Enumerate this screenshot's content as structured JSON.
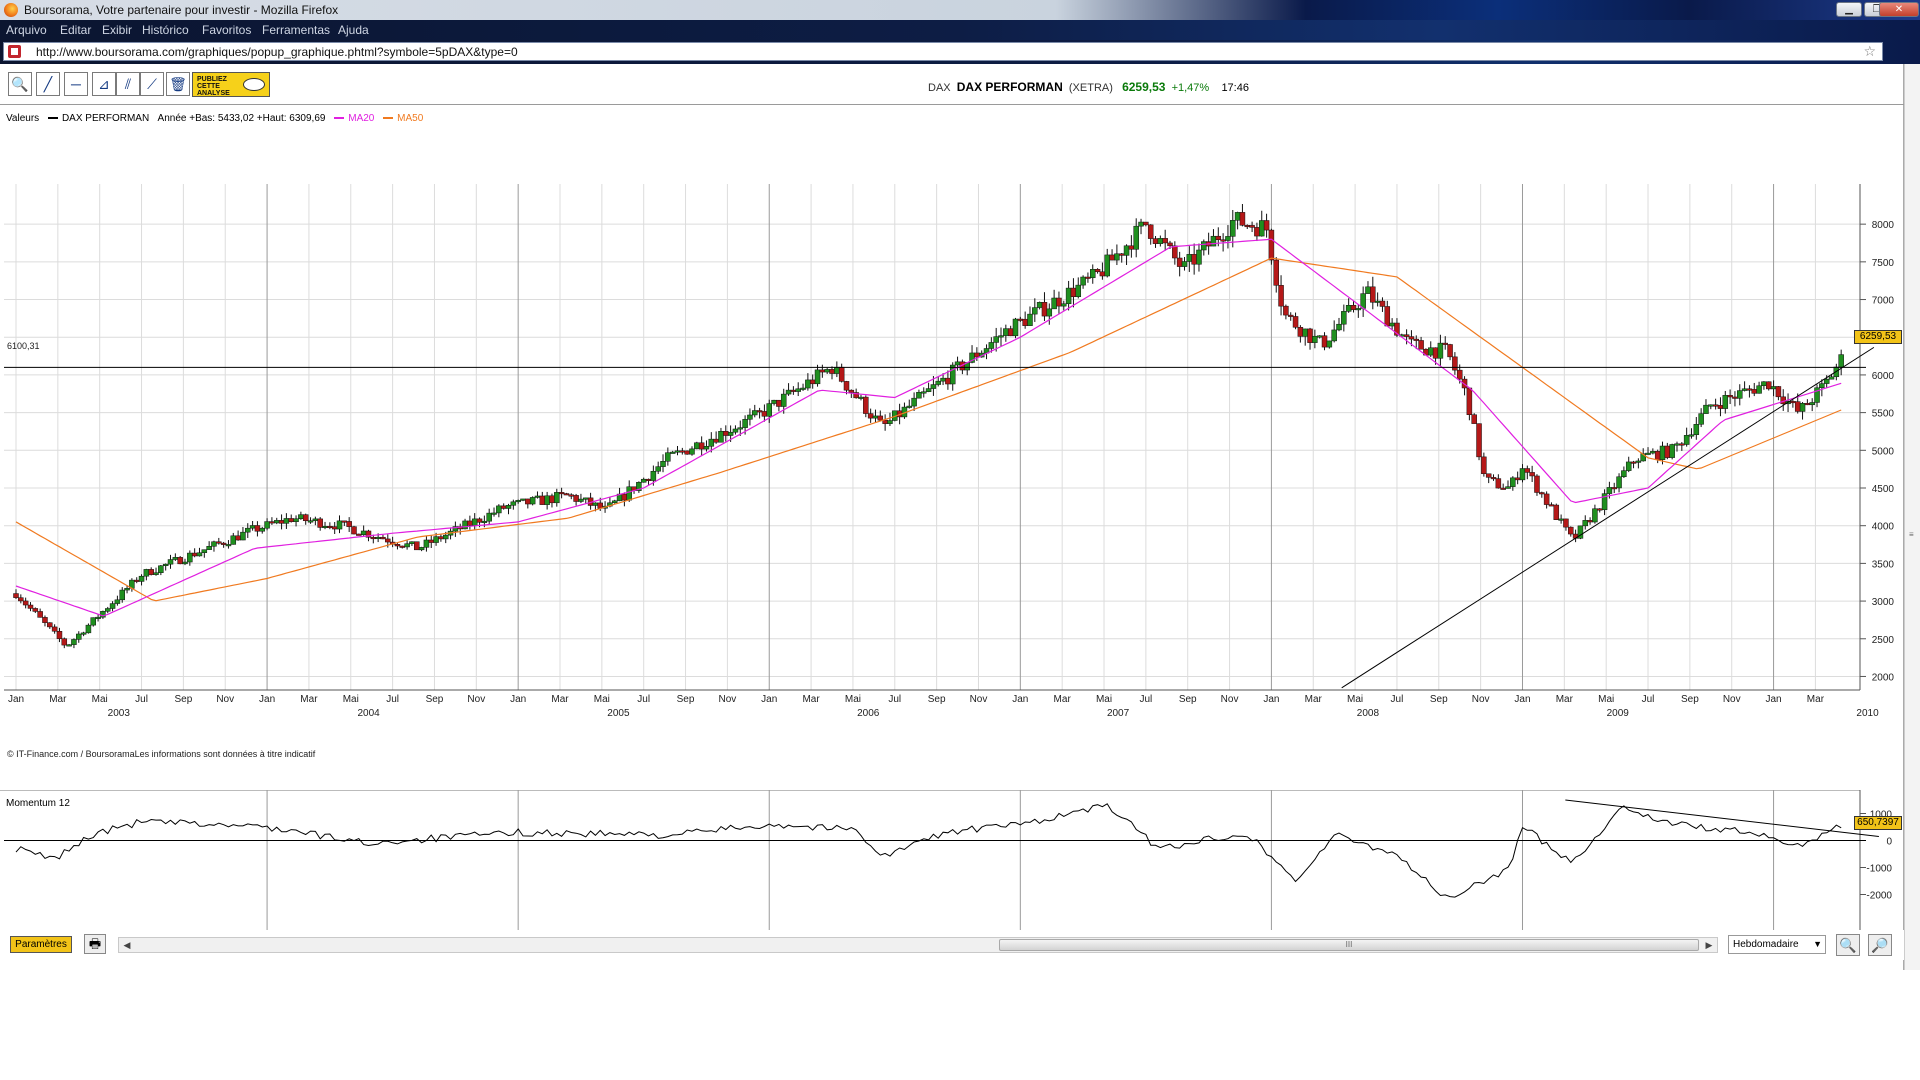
{
  "window": {
    "title": "Boursorama, Votre partenaire pour investir - Mozilla Firefox",
    "menu": [
      "Arquivo",
      "Editar",
      "Exibir",
      "Histórico",
      "Favoritos",
      "Ferramentas",
      "Ajuda"
    ],
    "url": "http://www.boursorama.com/graphiques/popup_graphique.phtml?symbole=5pDAX&type=0"
  },
  "toolbar": {
    "tools": [
      "zoom-tool",
      "trendline-tool",
      "horizontal-line-tool",
      "fibonacci-tool",
      "parallel-lines-tool",
      "fan-tool",
      "trash-tool"
    ],
    "publiez_label": "PUBLIEZ CETTE ANALYSE"
  },
  "quote": {
    "symbol": "DAX",
    "name": "DAX PERFORMAN",
    "market": "(XETRA)",
    "last": "6259,53",
    "change": "+1,47%",
    "time": "17:46"
  },
  "legend": {
    "valeurs": "Valeurs",
    "series_name": "DAX PERFORMAN",
    "year_range": "Année +Bas: 5433,02 +Haut: 6309,69",
    "ma20": "MA20",
    "ma50": "MA50"
  },
  "annotations": {
    "horizontal_line_label": "6100,31",
    "last_price_tag": "6259,53",
    "credit": "© IT-Finance.com / BoursoramaLes informations sont données à titre indicatif"
  },
  "momentum": {
    "label": "Momentum 12",
    "value_tag": "650,7397"
  },
  "bottom": {
    "params_label": "Paramètres",
    "period": "Hebdomadaire",
    "scroll_grip": "III"
  },
  "colors": {
    "up_candle": "#1f8f1f",
    "down_candle": "#b51818",
    "ma20": "#e020e0",
    "ma50": "#f07a20",
    "grid": "#dcdcdc",
    "quote_positive": "#0a7a0a",
    "highlight_tag": "#f2c318"
  },
  "chart_data": [
    {
      "type": "candlestick",
      "title": "DAX PERFORMAN",
      "x_axis": {
        "months": [
          "Jan",
          "Mar",
          "Mai",
          "Jul",
          "Sep",
          "Nov",
          "Jan",
          "Mar",
          "Mai",
          "Jul",
          "Sep",
          "Nov",
          "Jan",
          "Mar",
          "Mai",
          "Jul",
          "Sep",
          "Nov",
          "Jan",
          "Mar",
          "Mai",
          "Jul",
          "Sep",
          "Nov",
          "Jan",
          "Mar",
          "Mai",
          "Jul",
          "Sep",
          "Nov",
          "Jan",
          "Mar",
          "Mai",
          "Jul",
          "Sep",
          "Nov",
          "Jan",
          "Mar",
          "Mai",
          "Jul",
          "Sep",
          "Nov",
          "Jan",
          "Mar"
        ],
        "years": [
          "2003",
          "2004",
          "2005",
          "2006",
          "2007",
          "2008",
          "2009",
          "2010"
        ]
      },
      "y_axis": {
        "ticks": [
          2000,
          2500,
          3000,
          3500,
          4000,
          4500,
          5000,
          5500,
          6000,
          6500,
          7000,
          7500,
          8000
        ],
        "range": [
          1900,
          8400
        ]
      },
      "grid": true,
      "close_keypoints": [
        {
          "t": 2003.0,
          "v": 3100
        },
        {
          "t": 2003.2,
          "v": 2400
        },
        {
          "t": 2003.5,
          "v": 3350
        },
        {
          "t": 2003.95,
          "v": 3950
        },
        {
          "t": 2004.1,
          "v": 4100
        },
        {
          "t": 2004.3,
          "v": 4000
        },
        {
          "t": 2004.6,
          "v": 3700
        },
        {
          "t": 2004.95,
          "v": 4250
        },
        {
          "t": 2005.2,
          "v": 4400
        },
        {
          "t": 2005.35,
          "v": 4200
        },
        {
          "t": 2005.6,
          "v": 4900
        },
        {
          "t": 2005.95,
          "v": 5450
        },
        {
          "t": 2006.25,
          "v": 6100
        },
        {
          "t": 2006.45,
          "v": 5300
        },
        {
          "t": 2006.95,
          "v": 6600
        },
        {
          "t": 2007.3,
          "v": 7300
        },
        {
          "t": 2007.5,
          "v": 8000
        },
        {
          "t": 2007.65,
          "v": 7400
        },
        {
          "t": 2007.85,
          "v": 8050
        },
        {
          "t": 2007.98,
          "v": 7950
        },
        {
          "t": 2008.05,
          "v": 6800
        },
        {
          "t": 2008.2,
          "v": 6400
        },
        {
          "t": 2008.38,
          "v": 7100
        },
        {
          "t": 2008.55,
          "v": 6400
        },
        {
          "t": 2008.7,
          "v": 6300
        },
        {
          "t": 2008.78,
          "v": 5700
        },
        {
          "t": 2008.85,
          "v": 4600
        },
        {
          "t": 2008.95,
          "v": 4500
        },
        {
          "t": 2009.0,
          "v": 4800
        },
        {
          "t": 2009.2,
          "v": 3800
        },
        {
          "t": 2009.45,
          "v": 4900
        },
        {
          "t": 2009.6,
          "v": 5000
        },
        {
          "t": 2009.75,
          "v": 5600
        },
        {
          "t": 2009.98,
          "v": 5900
        },
        {
          "t": 2010.1,
          "v": 5500
        },
        {
          "t": 2010.2,
          "v": 5850
        },
        {
          "t": 2010.28,
          "v": 6259.53
        }
      ],
      "ma20_keypoints": [
        {
          "t": 2003.0,
          "v": 3200
        },
        {
          "t": 2003.35,
          "v": 2800
        },
        {
          "t": 2003.95,
          "v": 3700
        },
        {
          "t": 2004.5,
          "v": 3900
        },
        {
          "t": 2005.0,
          "v": 4050
        },
        {
          "t": 2005.5,
          "v": 4500
        },
        {
          "t": 2006.2,
          "v": 5800
        },
        {
          "t": 2006.5,
          "v": 5700
        },
        {
          "t": 2007.0,
          "v": 6500
        },
        {
          "t": 2007.6,
          "v": 7700
        },
        {
          "t": 2008.0,
          "v": 7800
        },
        {
          "t": 2008.4,
          "v": 6800
        },
        {
          "t": 2008.8,
          "v": 5800
        },
        {
          "t": 2009.2,
          "v": 4300
        },
        {
          "t": 2009.5,
          "v": 4500
        },
        {
          "t": 2009.8,
          "v": 5400
        },
        {
          "t": 2010.28,
          "v": 5900
        }
      ],
      "ma50_keypoints": [
        {
          "t": 2003.0,
          "v": 4050
        },
        {
          "t": 2003.55,
          "v": 3000
        },
        {
          "t": 2004.0,
          "v": 3300
        },
        {
          "t": 2004.6,
          "v": 3850
        },
        {
          "t": 2005.2,
          "v": 4100
        },
        {
          "t": 2005.8,
          "v": 4700
        },
        {
          "t": 2006.5,
          "v": 5450
        },
        {
          "t": 2007.2,
          "v": 6300
        },
        {
          "t": 2008.0,
          "v": 7550
        },
        {
          "t": 2008.5,
          "v": 7300
        },
        {
          "t": 2009.0,
          "v": 6100
        },
        {
          "t": 2009.5,
          "v": 4900
        },
        {
          "t": 2009.7,
          "v": 4750
        },
        {
          "t": 2010.28,
          "v": 5550
        }
      ],
      "horizontal_line": 6100.31,
      "trendline": [
        {
          "t": 2008.28,
          "v": 1850
        },
        {
          "t": 2010.3,
          "v": 6100
        }
      ],
      "last_value": 6259.53
    },
    {
      "type": "line",
      "title": "Momentum 12",
      "y_axis": {
        "ticks": [
          -2000,
          -1000,
          0,
          1000
        ],
        "range": [
          -2500,
          1500
        ]
      },
      "keypoints": [
        {
          "t": 2003.0,
          "v": -300
        },
        {
          "t": 2003.15,
          "v": -700
        },
        {
          "t": 2003.3,
          "v": 200
        },
        {
          "t": 2003.5,
          "v": 700
        },
        {
          "t": 2004.0,
          "v": 500
        },
        {
          "t": 2004.4,
          "v": -100
        },
        {
          "t": 2005.0,
          "v": 300
        },
        {
          "t": 2005.6,
          "v": 200
        },
        {
          "t": 2006.0,
          "v": 600
        },
        {
          "t": 2006.35,
          "v": 400
        },
        {
          "t": 2006.45,
          "v": -600
        },
        {
          "t": 2006.7,
          "v": 300
        },
        {
          "t": 2007.0,
          "v": 600
        },
        {
          "t": 2007.35,
          "v": 1300
        },
        {
          "t": 2007.55,
          "v": -300
        },
        {
          "t": 2007.9,
          "v": 300
        },
        {
          "t": 2008.1,
          "v": -1500
        },
        {
          "t": 2008.25,
          "v": 200
        },
        {
          "t": 2008.5,
          "v": -500
        },
        {
          "t": 2008.7,
          "v": -2200
        },
        {
          "t": 2008.95,
          "v": -1000
        },
        {
          "t": 2009.0,
          "v": 500
        },
        {
          "t": 2009.2,
          "v": -800
        },
        {
          "t": 2009.4,
          "v": 1250
        },
        {
          "t": 2009.6,
          "v": 600
        },
        {
          "t": 2009.9,
          "v": 300
        },
        {
          "t": 2010.1,
          "v": -200
        },
        {
          "t": 2010.28,
          "v": 650.7397
        }
      ],
      "trendline": [
        {
          "t": 2009.33,
          "v": 1500
        },
        {
          "t": 2010.3,
          "v": 150
        }
      ]
    }
  ]
}
